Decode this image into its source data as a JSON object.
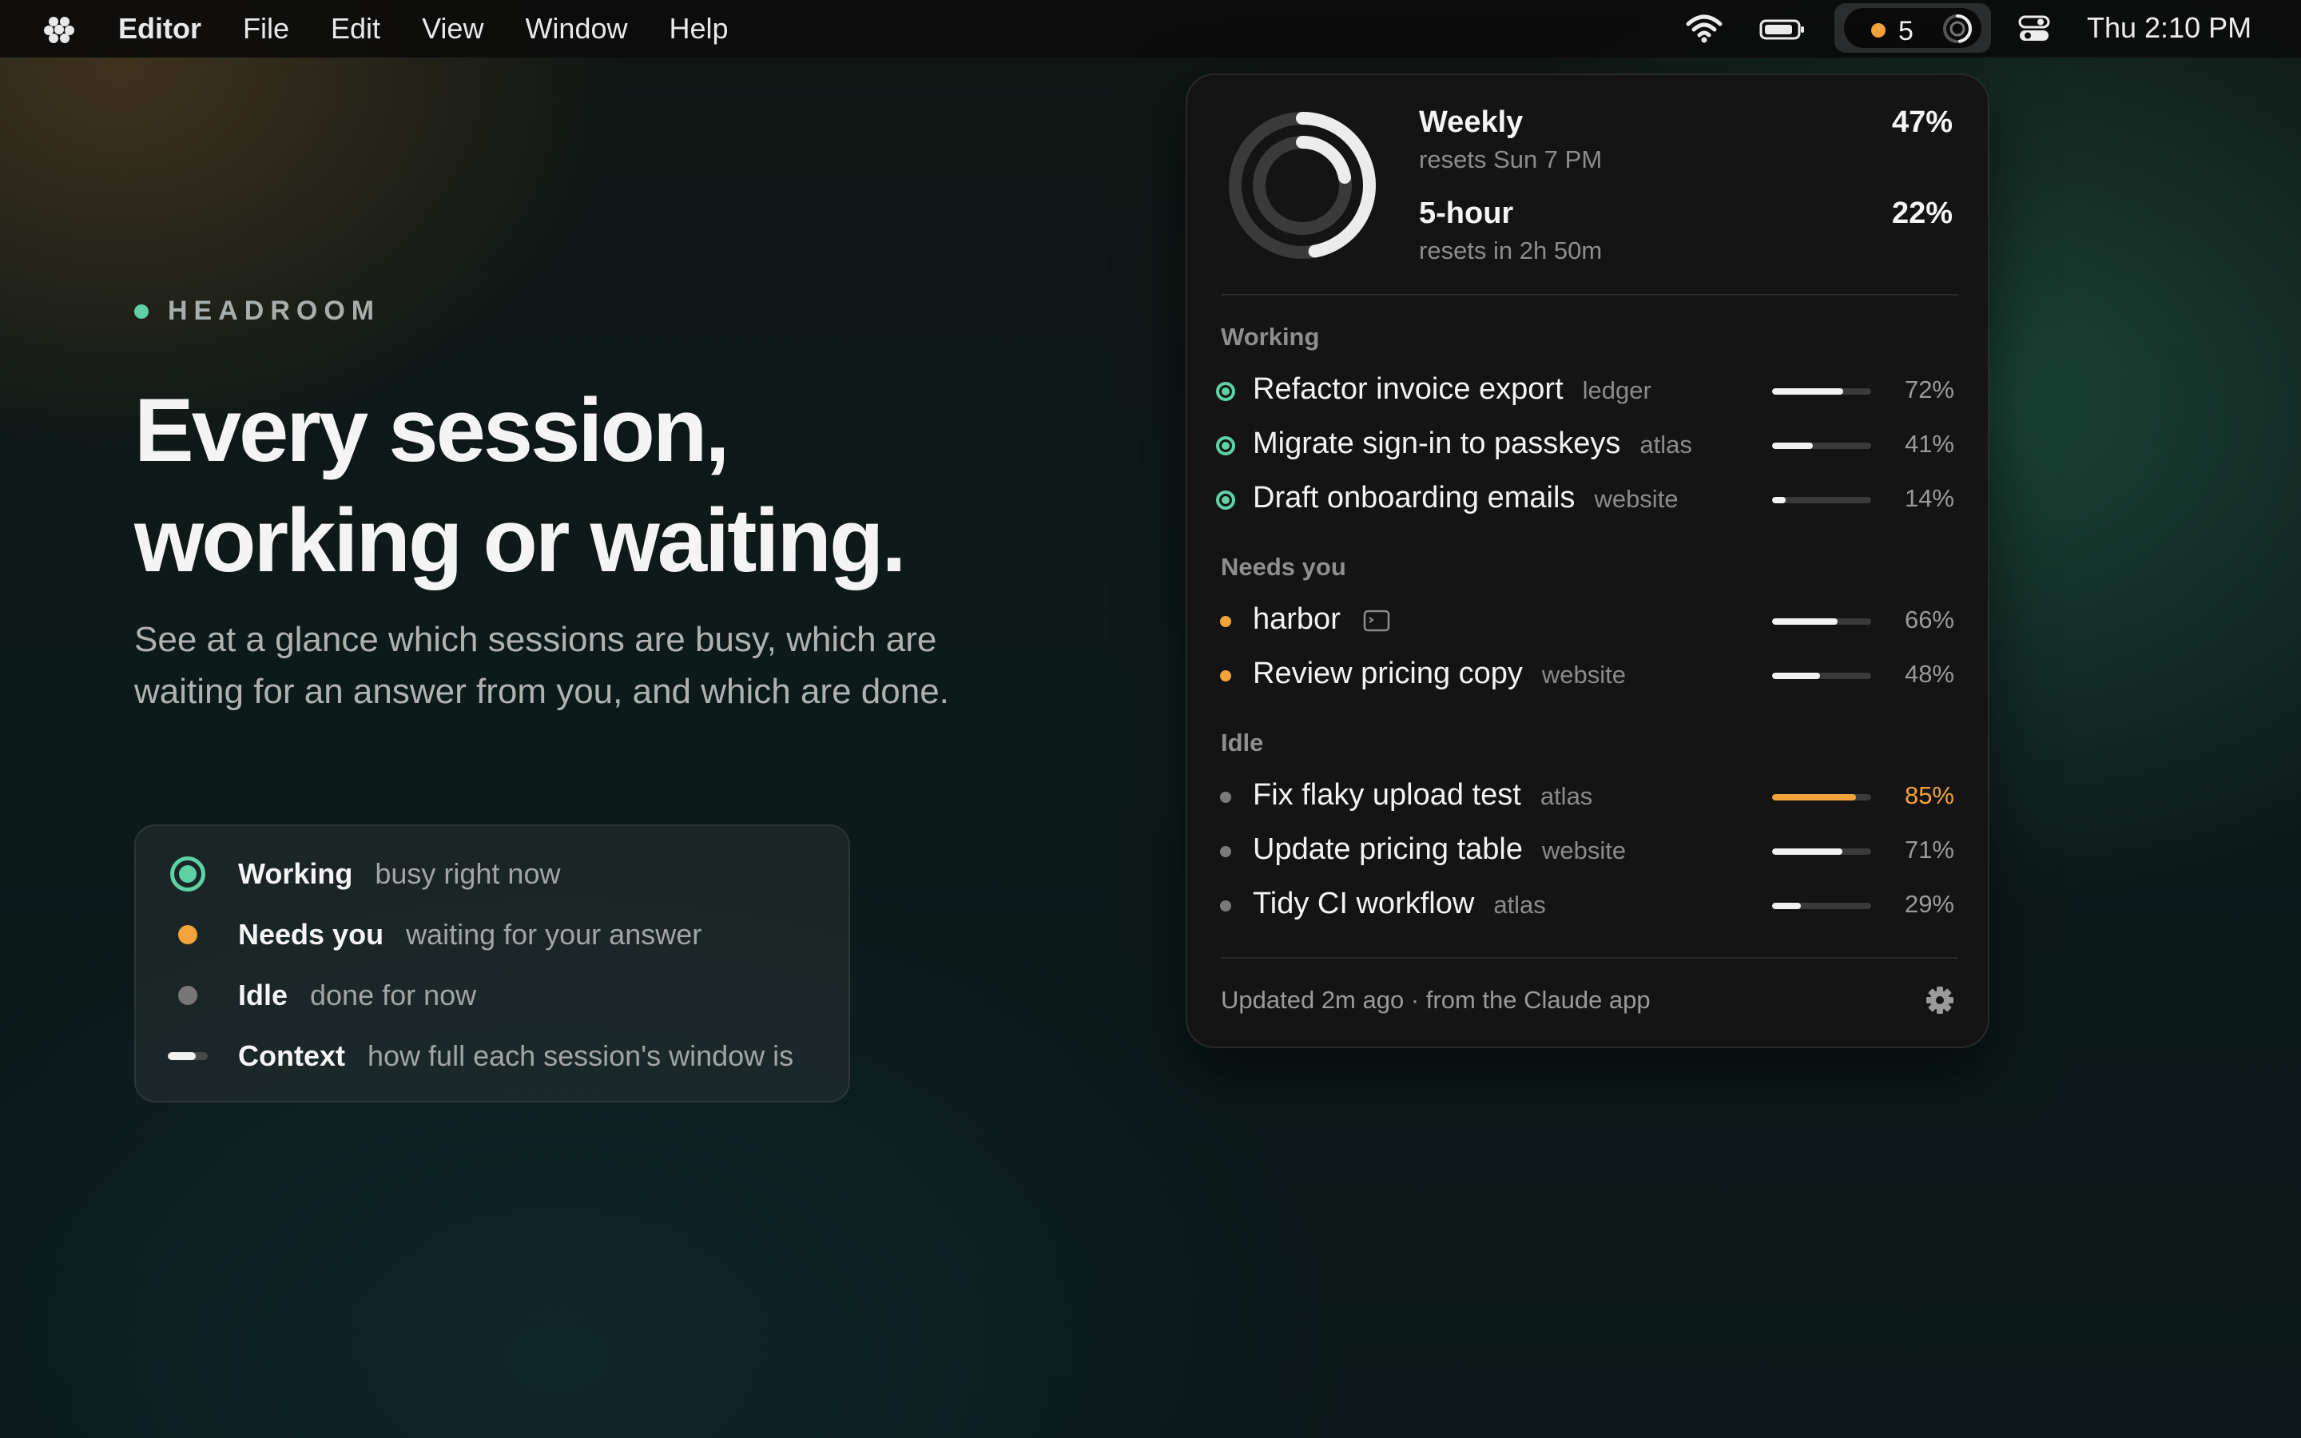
{
  "menubar": {
    "app_name": "Editor",
    "menus": [
      "File",
      "Edit",
      "View",
      "Window",
      "Help"
    ],
    "status_count": "5",
    "clock": "Thu 2:10 PM"
  },
  "hero": {
    "eyebrow": "HEADROOM",
    "headline_line1": "Every session,",
    "headline_line2": "working or waiting.",
    "subhead": "See at a glance which sessions are busy, which are waiting for an answer from you, and which are done."
  },
  "legend": [
    {
      "key": "Working",
      "desc": "busy right now",
      "icon": "working-ring-icon"
    },
    {
      "key": "Needs you",
      "desc": "waiting for your answer",
      "icon": "needs-you-dot-icon"
    },
    {
      "key": "Idle",
      "desc": "done for now",
      "icon": "idle-dot-icon"
    },
    {
      "key": "Context",
      "desc": "how full each session's window is",
      "icon": "context-bar-icon"
    }
  ],
  "popover": {
    "limits": [
      {
        "name": "Weekly",
        "reset": "resets Sun 7 PM",
        "pct": "47%",
        "value": 0.47
      },
      {
        "name": "5-hour",
        "reset": "resets in 2h 50m",
        "pct": "22%",
        "value": 0.22
      }
    ],
    "sections": [
      {
        "title": "Working",
        "status": "working",
        "items": [
          {
            "title": "Refactor invoice export",
            "tag": "ledger",
            "pct": "72%",
            "value": 0.72
          },
          {
            "title": "Migrate sign-in to passkeys",
            "tag": "atlas",
            "pct": "41%",
            "value": 0.41
          },
          {
            "title": "Draft onboarding emails",
            "tag": "website",
            "pct": "14%",
            "value": 0.14
          }
        ]
      },
      {
        "title": "Needs you",
        "status": "needs",
        "items": [
          {
            "title": "harbor",
            "tag": "",
            "terminal_icon": true,
            "pct": "66%",
            "value": 0.66
          },
          {
            "title": "Review pricing copy",
            "tag": "website",
            "pct": "48%",
            "value": 0.48
          }
        ]
      },
      {
        "title": "Idle",
        "status": "idle",
        "items": [
          {
            "title": "Fix flaky upload test",
            "tag": "atlas",
            "pct": "85%",
            "value": 0.85,
            "warn": true
          },
          {
            "title": "Update pricing table",
            "tag": "website",
            "pct": "71%",
            "value": 0.71
          },
          {
            "title": "Tidy CI workflow",
            "tag": "atlas",
            "pct": "29%",
            "value": 0.29
          }
        ]
      }
    ],
    "footer": "Updated 2m ago · from the Claude app"
  },
  "colors": {
    "working": "#5fd1a6",
    "needs": "#f2a33a",
    "idle": "#8a8a8a",
    "warn": "#f2a33a"
  }
}
